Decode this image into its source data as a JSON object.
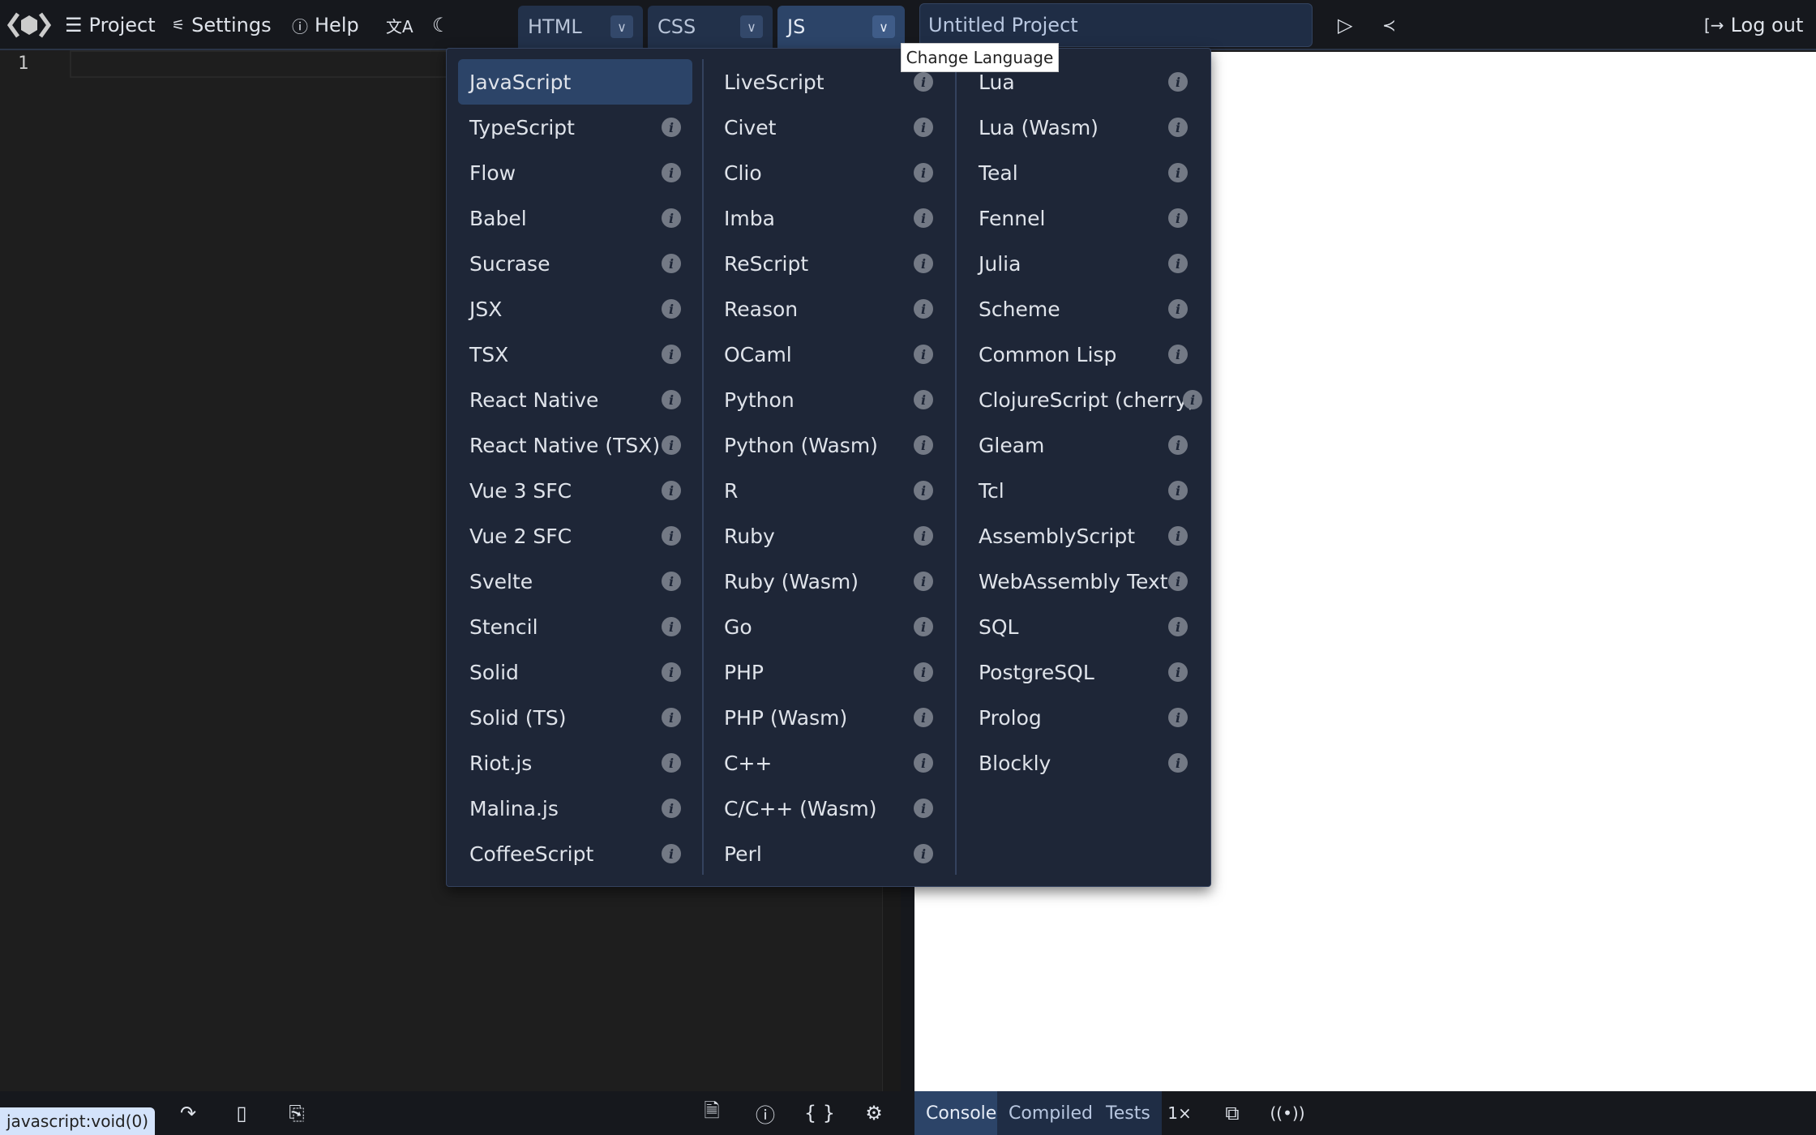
{
  "header": {
    "project_label": "Project",
    "settings_label": "Settings",
    "help_label": "Help",
    "tabs": [
      {
        "label": "HTML"
      },
      {
        "label": "CSS"
      },
      {
        "label": "JS",
        "active": true
      }
    ],
    "title_value": "Untitled Project",
    "logout_label": "Log out",
    "icons": [
      "logo-icon",
      "menu-icon",
      "sliders-icon",
      "help-icon",
      "translate-icon",
      "moon-icon",
      "chevron-down-icon",
      "play-icon",
      "share-icon",
      "logout-icon"
    ]
  },
  "editor": {
    "line_number": "1"
  },
  "tooltip": "Change Language",
  "menu": {
    "selected": "JavaScript",
    "columns": [
      [
        "JavaScript",
        "TypeScript",
        "Flow",
        "Babel",
        "Sucrase",
        "JSX",
        "TSX",
        "React Native",
        "React Native (TSX)",
        "Vue 3 SFC",
        "Vue 2 SFC",
        "Svelte",
        "Stencil",
        "Solid",
        "Solid (TS)",
        "Riot.js",
        "Malina.js",
        "CoffeeScript"
      ],
      [
        "LiveScript",
        "Civet",
        "Clio",
        "Imba",
        "ReScript",
        "Reason",
        "OCaml",
        "Python",
        "Python (Wasm)",
        "R",
        "Ruby",
        "Ruby (Wasm)",
        "Go",
        "PHP",
        "PHP (Wasm)",
        "C++",
        "C/C++ (Wasm)",
        "Perl"
      ],
      [
        "Lua",
        "Lua (Wasm)",
        "Teal",
        "Fennel",
        "Julia",
        "Scheme",
        "Common Lisp",
        "ClojureScript (cherry)",
        "Gleam",
        "Tcl",
        "AssemblyScript",
        "WebAssembly Text",
        "SQL",
        "PostgreSQL",
        "Prolog",
        "Blockly"
      ]
    ]
  },
  "bottom": {
    "status": "javascript:void(0)",
    "tabs": [
      {
        "label": "Console",
        "active": true
      },
      {
        "label": "Compiled"
      },
      {
        "label": "Tests"
      }
    ],
    "speed": "1×"
  },
  "colors": {
    "accent": "#2c4468",
    "header_bg": "#16181d",
    "menu_bg": "#1e2637"
  }
}
